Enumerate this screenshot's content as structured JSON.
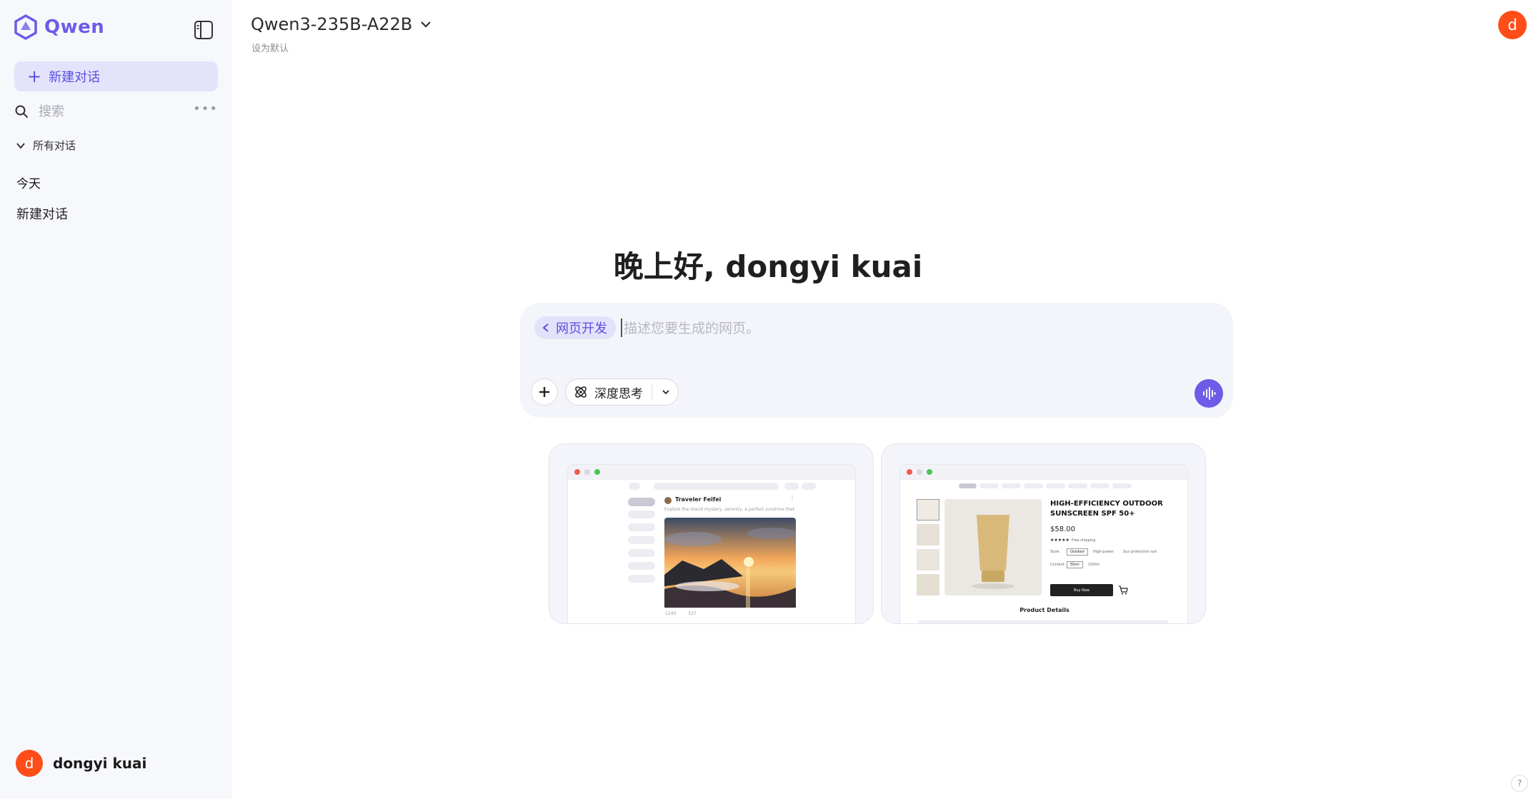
{
  "sidebar": {
    "logo_text": "Qwen",
    "new_chat_label": "新建对话",
    "search_placeholder": "搜索",
    "all_chats_label": "所有对话",
    "group_today": "今天",
    "chats": [
      {
        "title": "新建对话"
      }
    ],
    "user": {
      "initial": "d",
      "name": "dongyi kuai"
    }
  },
  "header": {
    "model_name": "Qwen3-235B-A22B",
    "set_default": "设为默认",
    "avatar_initial": "d"
  },
  "main": {
    "greeting": "晚上好, dongyi kuai",
    "composer": {
      "mode_chip": "网页开发",
      "placeholder": "描述您要生成的网页。",
      "think_label": "深度思考"
    },
    "templates": [
      {
        "author": "Traveler Feifei",
        "caption": "Explore the island mystery, serenity, a perfect sunshine that",
        "stats": [
          "1240",
          "327"
        ]
      },
      {
        "title": "HIGH-EFFICIENCY OUTDOOR SUNSCREEN SPF 50+",
        "price": "$58.00",
        "rating_text": "★★★★★",
        "shipping": "Free shipping",
        "style_label": "Style",
        "style_options": [
          "Outdoor",
          "High-power",
          "Sun protection suit"
        ],
        "content_label": "Content",
        "content_options": [
          "50ml",
          "100ml"
        ],
        "buy_label": "Buy Now",
        "details_label": "Product Details"
      }
    ]
  },
  "help_label": "?",
  "colors": {
    "accent": "#6c5ce7",
    "avatar": "#ff4d1a",
    "sidebar_bg": "#f7f8fc"
  }
}
